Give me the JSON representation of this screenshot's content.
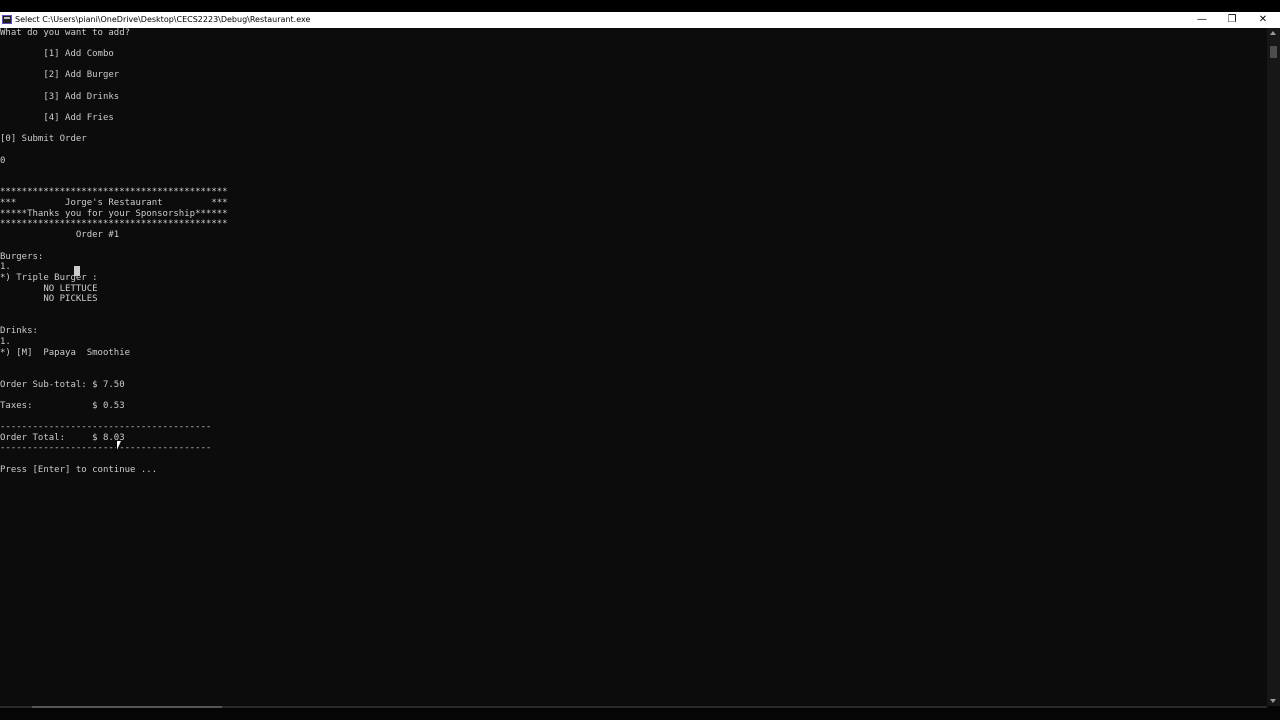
{
  "window": {
    "title": "Select C:\\Users\\piani\\OneDrive\\Desktop\\CECS2223\\Debug\\Restaurant.exe",
    "controls": {
      "minimize": "—",
      "restore": "❐",
      "close": "✕"
    }
  },
  "console": {
    "lines": [
      "What do you want to add?",
      "        [1] Add Combo",
      "        [2] Add Burger",
      "        [3] Add Drinks",
      "        [4] Add Fries",
      "[0] Submit Order",
      "0",
      "******************************************",
      "***         Jorge's Restaurant         ***",
      "*****Thanks you for your Sponsorship******",
      "******************************************",
      "              Order #1",
      "Burgers:",
      "1.",
      "*) Triple Burger :",
      "        NO LETTUCE",
      "        NO PICKLES",
      "Drinks:",
      "1.",
      "*) [M]  Papaya  Smoothie",
      "Order Sub-total: $ 7.50",
      "Taxes:           $ 0.53",
      "---------------------------------------",
      "Order Total:     $ 8.03",
      "---------------------------------------",
      "Press [Enter] to continue ..."
    ]
  },
  "colors": {
    "background": "#0c0c0c",
    "text": "#cccccc",
    "titlebar": "#ffffff"
  }
}
